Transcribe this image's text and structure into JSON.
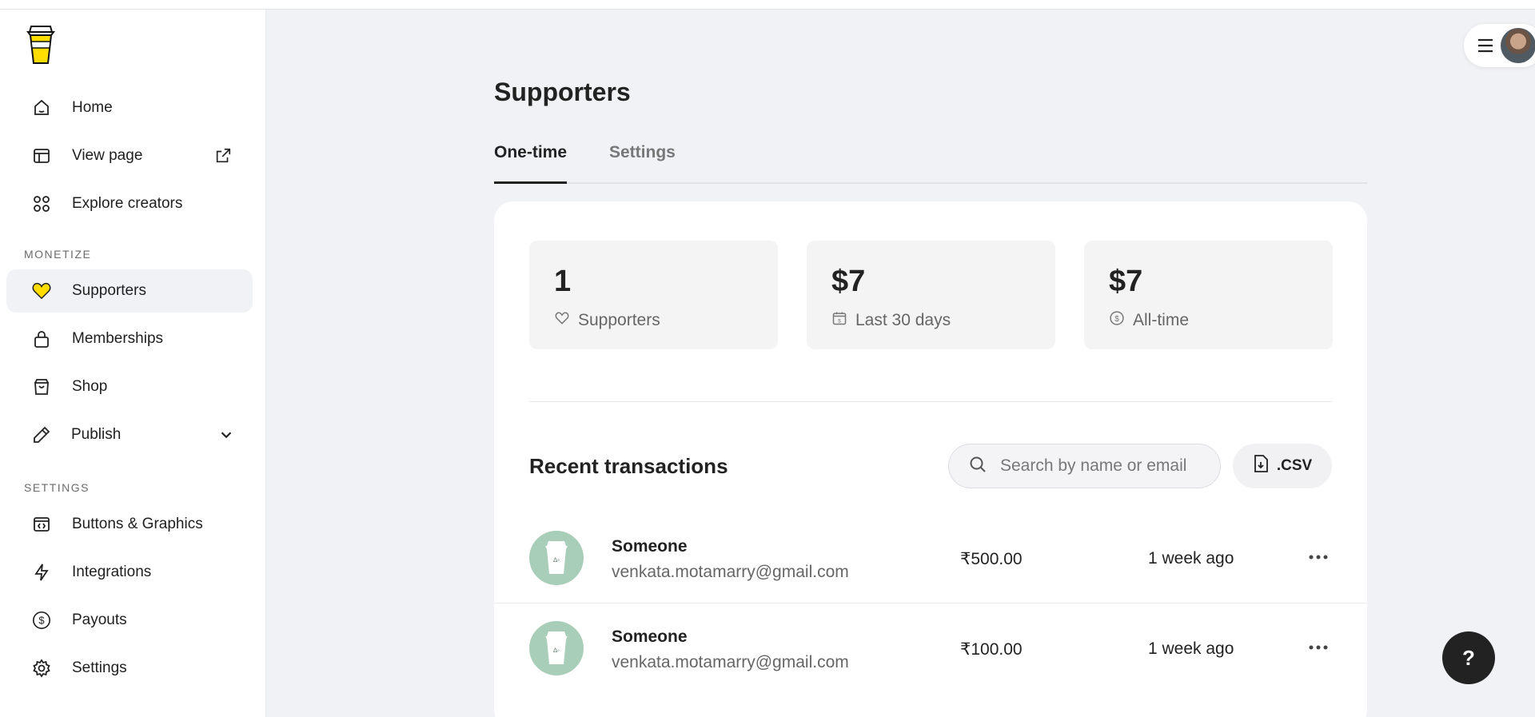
{
  "sidebar": {
    "nav": [
      {
        "label": "Home",
        "icon": "home-icon"
      },
      {
        "label": "View page",
        "icon": "layout-icon",
        "extra": "external-link-icon"
      },
      {
        "label": "Explore creators",
        "icon": "grid-icon"
      }
    ],
    "monetize_label": "MONETIZE",
    "monetize": [
      {
        "label": "Supporters",
        "icon": "heart-icon",
        "active": true
      },
      {
        "label": "Memberships",
        "icon": "lock-icon"
      },
      {
        "label": "Shop",
        "icon": "bag-icon"
      },
      {
        "label": "Publish",
        "icon": "pencil-icon",
        "extra": "chevron-down-icon"
      }
    ],
    "settings_label": "SETTINGS",
    "settings": [
      {
        "label": "Buttons & Graphics",
        "icon": "code-icon"
      },
      {
        "label": "Integrations",
        "icon": "lightning-icon"
      },
      {
        "label": "Payouts",
        "icon": "dollar-circle-icon"
      },
      {
        "label": "Settings",
        "icon": "gear-icon"
      }
    ]
  },
  "main": {
    "title": "Supporters",
    "tabs": [
      "One-time",
      "Settings"
    ],
    "stats": [
      {
        "value": "1",
        "label": "Supporters",
        "icon": "heart-icon"
      },
      {
        "value": "$7",
        "label": "Last 30 days",
        "icon": "calendar-icon"
      },
      {
        "value": "$7",
        "label": "All-time",
        "icon": "dollar-circle-icon"
      }
    ],
    "recent_title": "Recent transactions",
    "search_placeholder": "Search by name or email",
    "csv_label": ".CSV",
    "transactions": [
      {
        "name": "Someone",
        "email": "venkata.motamarry@gmail.com",
        "amount": "₹500.00",
        "time": "1 week ago"
      },
      {
        "name": "Someone",
        "email": "venkata.motamarry@gmail.com",
        "amount": "₹100.00",
        "time": "1 week ago"
      }
    ]
  },
  "help_label": "?",
  "colors": {
    "accent": "#ffdd00",
    "avatar_bg": "#a8cdb8",
    "active_bg": "#f1f2f6"
  }
}
